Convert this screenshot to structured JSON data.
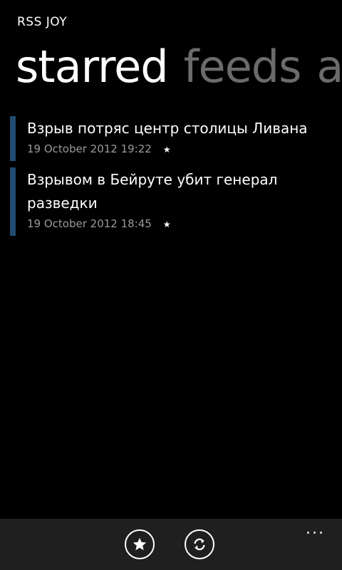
{
  "app": {
    "title": "RSS JOY"
  },
  "pivot": {
    "items": [
      {
        "label": "starred"
      },
      {
        "label": "feeds"
      },
      {
        "label": "a"
      }
    ]
  },
  "starred_items": [
    {
      "title": "Взрыв потряс центр столицы Ливана",
      "date": "19 October 2012 19:22",
      "starred_icon": "star-icon"
    },
    {
      "title": "Взрывом в Бейруте убит генерал разведки",
      "date": "19 October 2012 18:45",
      "starred_icon": "star-icon"
    }
  ],
  "appbar": {
    "buttons": [
      {
        "icon": "star-icon"
      },
      {
        "icon": "refresh-icon"
      }
    ],
    "more_label": "..."
  },
  "colors": {
    "background": "#000000",
    "accent_bar": "#1f4c70",
    "inactive_pivot": "#6b6b6b",
    "meta_text": "#9a9a9a",
    "appbar_bg": "#1f1f1f"
  }
}
